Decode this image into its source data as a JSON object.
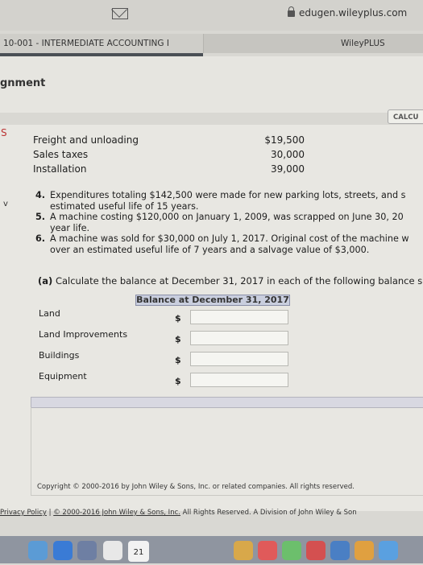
{
  "browser": {
    "url": "edugen.wileyplus.com"
  },
  "tabs": [
    {
      "label": "10-001 - INTERMEDIATE ACCOUNTING I"
    },
    {
      "label": "WileyPLUS"
    }
  ],
  "page": {
    "title": "gnment",
    "calculator_label": "CALCU"
  },
  "sidebar_marks": {
    "top": "S",
    "bottom": "v"
  },
  "cost_items": [
    {
      "label": "Freight and unloading",
      "amount": "$19,500"
    },
    {
      "label": "Sales taxes",
      "amount": "30,000"
    },
    {
      "label": "Installation",
      "amount": "39,000"
    }
  ],
  "questions": [
    {
      "num": "4.",
      "line1": "Expenditures totaling $142,500 were made for new parking lots, streets, and s",
      "line2": "estimated useful life of 15 years."
    },
    {
      "num": "5.",
      "line1": "A machine costing $120,000 on January 1, 2009, was scrapped on June 30, 20",
      "line2": "year life."
    },
    {
      "num": "6.",
      "line1": "A machine was sold for $30,000 on July 1, 2017. Original cost of the machine w",
      "line2": "over an estimated useful life of 7 years and a salvage value of $3,000."
    }
  ],
  "part_a": {
    "label": "(a)",
    "text": "Calculate the balance at December 31, 2017 in each of the following balance sh"
  },
  "balance_table": {
    "header": "Balance at December 31, 2017",
    "rows": [
      {
        "label": "Land",
        "currency": "$",
        "value": ""
      },
      {
        "label": "Land Improvements",
        "currency": "$",
        "value": ""
      },
      {
        "label": "Buildings",
        "currency": "$",
        "value": ""
      },
      {
        "label": "Equipment",
        "currency": "$",
        "value": ""
      }
    ]
  },
  "copyright": "Copyright © 2000-2016 by John Wiley & Sons, Inc. or related companies. All rights reserved.",
  "footer": {
    "privacy": "Privacy Policy",
    "separator": "|",
    "copyright_link": "© 2000-2016 John Wiley & Sons, Inc.",
    "rest": " All Rights Reserved. A Division of John Wiley & Son"
  },
  "dock": {
    "calendar_day": "21"
  },
  "colors": {
    "header_fill": "#c9cede",
    "bar_fill": "#d8d8e1",
    "nav_strip": "#4a4f55"
  }
}
